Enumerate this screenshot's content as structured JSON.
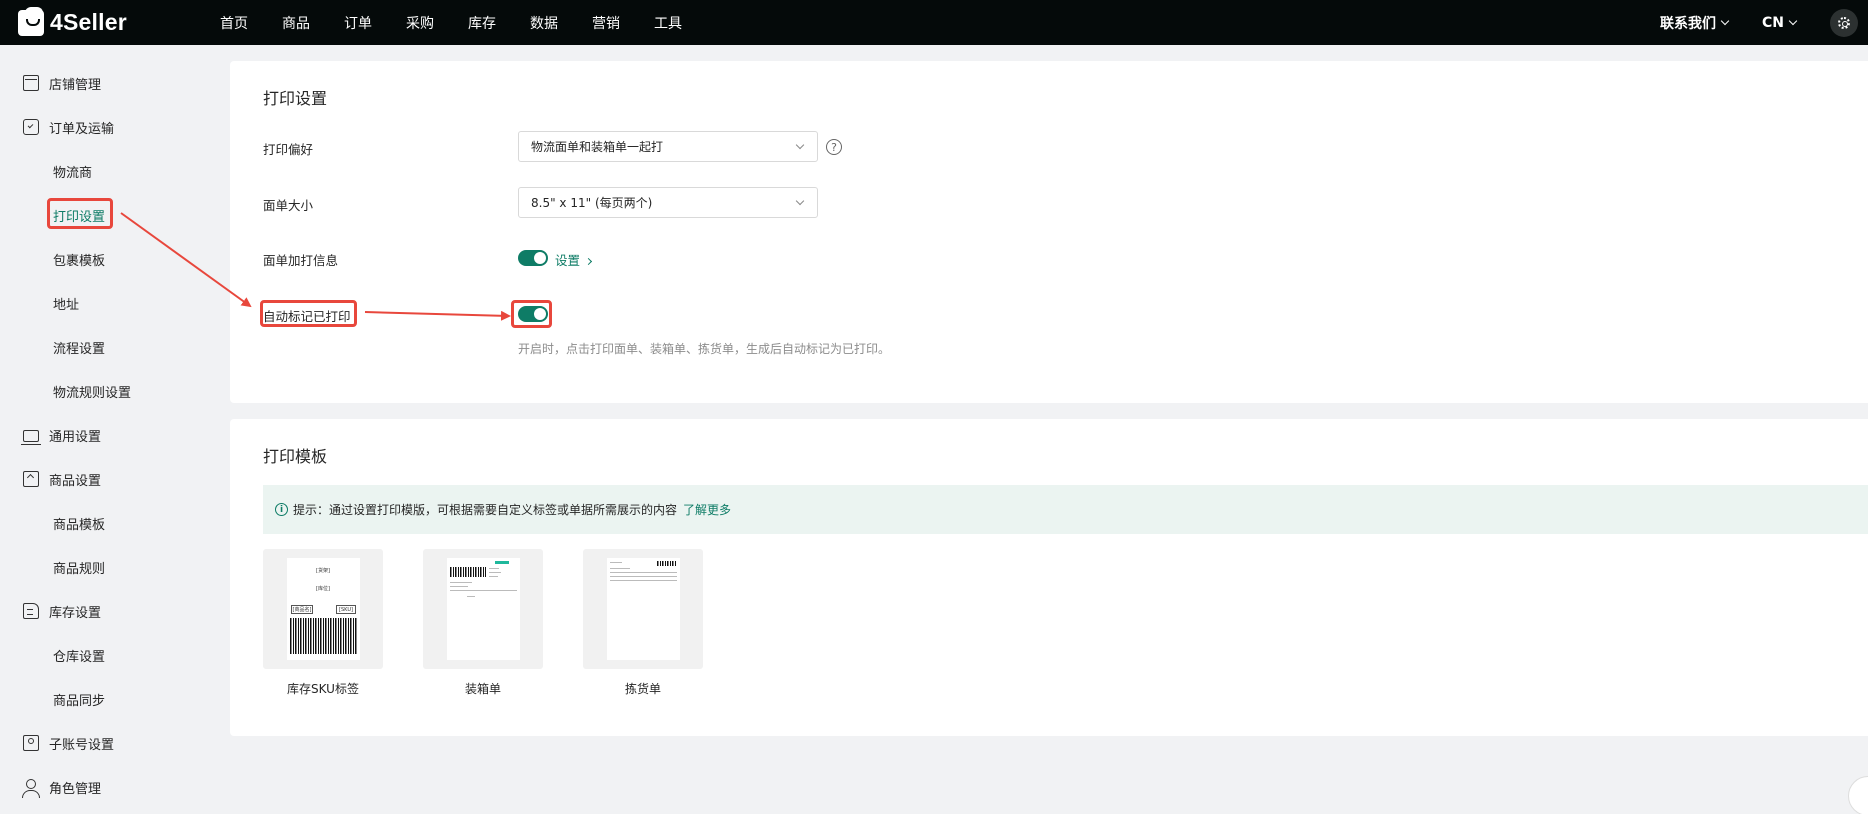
{
  "topbar": {
    "logo_text": "4Seller",
    "nav": [
      "首页",
      "商品",
      "订单",
      "采购",
      "库存",
      "数据",
      "营销",
      "工具"
    ],
    "contact_label": "联系我们",
    "lang_label": "CN"
  },
  "sidebar": {
    "items": [
      {
        "label": "店铺管理",
        "icon": "store-icon"
      },
      {
        "label": "订单及运输",
        "icon": "order-icon"
      },
      {
        "label": "物流商"
      },
      {
        "label": "打印设置",
        "active": true
      },
      {
        "label": "包裹模板"
      },
      {
        "label": "地址"
      },
      {
        "label": "流程设置"
      },
      {
        "label": "物流规则设置"
      },
      {
        "label": "通用设置",
        "icon": "general-settings-icon"
      },
      {
        "label": "商品设置",
        "icon": "product-settings-icon"
      },
      {
        "label": "商品模板"
      },
      {
        "label": "商品规则"
      },
      {
        "label": "库存设置",
        "icon": "inventory-settings-icon"
      },
      {
        "label": "仓库设置"
      },
      {
        "label": "商品同步"
      },
      {
        "label": "子账号设置",
        "icon": "sub-account-icon"
      },
      {
        "label": "角色管理",
        "icon": "role-icon"
      }
    ]
  },
  "print_settings": {
    "title": "打印设置",
    "preference_label": "打印偏好",
    "preference_value": "物流面单和装箱单一起打",
    "size_label": "面单大小",
    "size_value": "8.5\" x 11\" (每页两个)",
    "extra_info_label": "面单加打信息",
    "extra_info_enabled": true,
    "extra_info_link": "设置",
    "auto_mark_label": "自动标记已打印",
    "auto_mark_enabled": true,
    "auto_mark_hint": "开启时，点击打印面单、装箱单、拣货单，生成后自动标记为已打印。"
  },
  "print_templates": {
    "title": "打印模板",
    "tip_text": "提示：通过设置打印模版，可根据需要自定义标签或单据所需展示的内容",
    "tip_link": "了解更多",
    "templates": [
      {
        "name": "库存SKU标签",
        "thumb_text_1": "[货架]",
        "thumb_text_2": "[库位]",
        "thumb_text_3": "[商品名]",
        "thumb_text_4": "[SKU]"
      },
      {
        "name": "装箱单"
      },
      {
        "name": "拣货单"
      }
    ]
  },
  "colors": {
    "accent": "#0e7c66",
    "annotation": "#e8473c",
    "topbar": "#050a0a"
  }
}
